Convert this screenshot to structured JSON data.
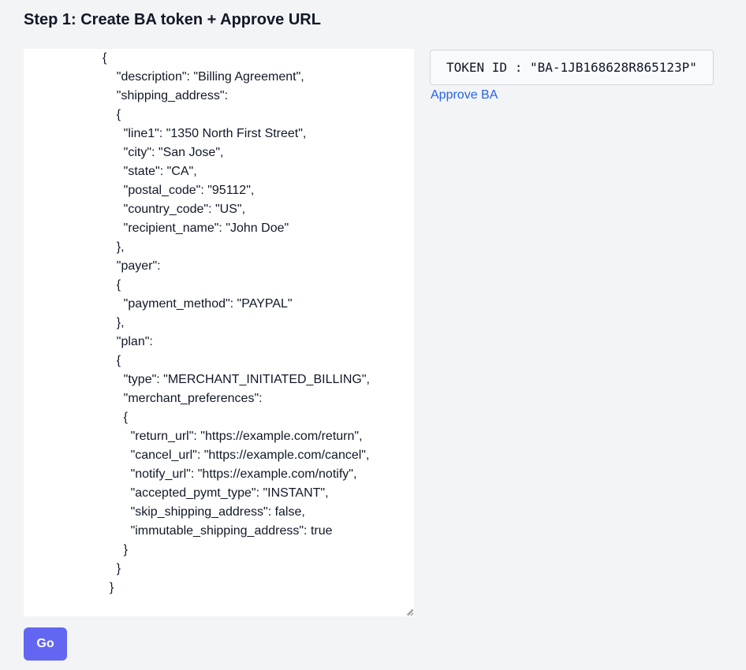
{
  "page": {
    "title": "Step 1: Create BA token + Approve URL"
  },
  "request_editor": {
    "content": "{\n    \"description\": \"Billing Agreement\",\n    \"shipping_address\":\n    {\n      \"line1\": \"1350 North First Street\",\n      \"city\": \"San Jose\",\n      \"state\": \"CA\",\n      \"postal_code\": \"95112\",\n      \"country_code\": \"US\",\n      \"recipient_name\": \"John Doe\"\n    },\n    \"payer\":\n    {\n      \"payment_method\": \"PAYPAL\"\n    },\n    \"plan\":\n    {\n      \"type\": \"MERCHANT_INITIATED_BILLING\",\n      \"merchant_preferences\":\n      {\n        \"return_url\": \"https://example.com/return\",\n        \"cancel_url\": \"https://example.com/cancel\",\n        \"notify_url\": \"https://example.com/notify\",\n        \"accepted_pymt_type\": \"INSTANT\",\n        \"skip_shipping_address\": false,\n        \"immutable_shipping_address\": true\n      }\n    }\n  }"
  },
  "actions": {
    "go_label": "Go",
    "approve_label": "Approve BA"
  },
  "token": {
    "text": "TOKEN ID : \"BA-1JB168628R865123P\""
  },
  "colors": {
    "accent": "#6366f1",
    "link": "#2563eb",
    "background": "#f3f4f6"
  }
}
